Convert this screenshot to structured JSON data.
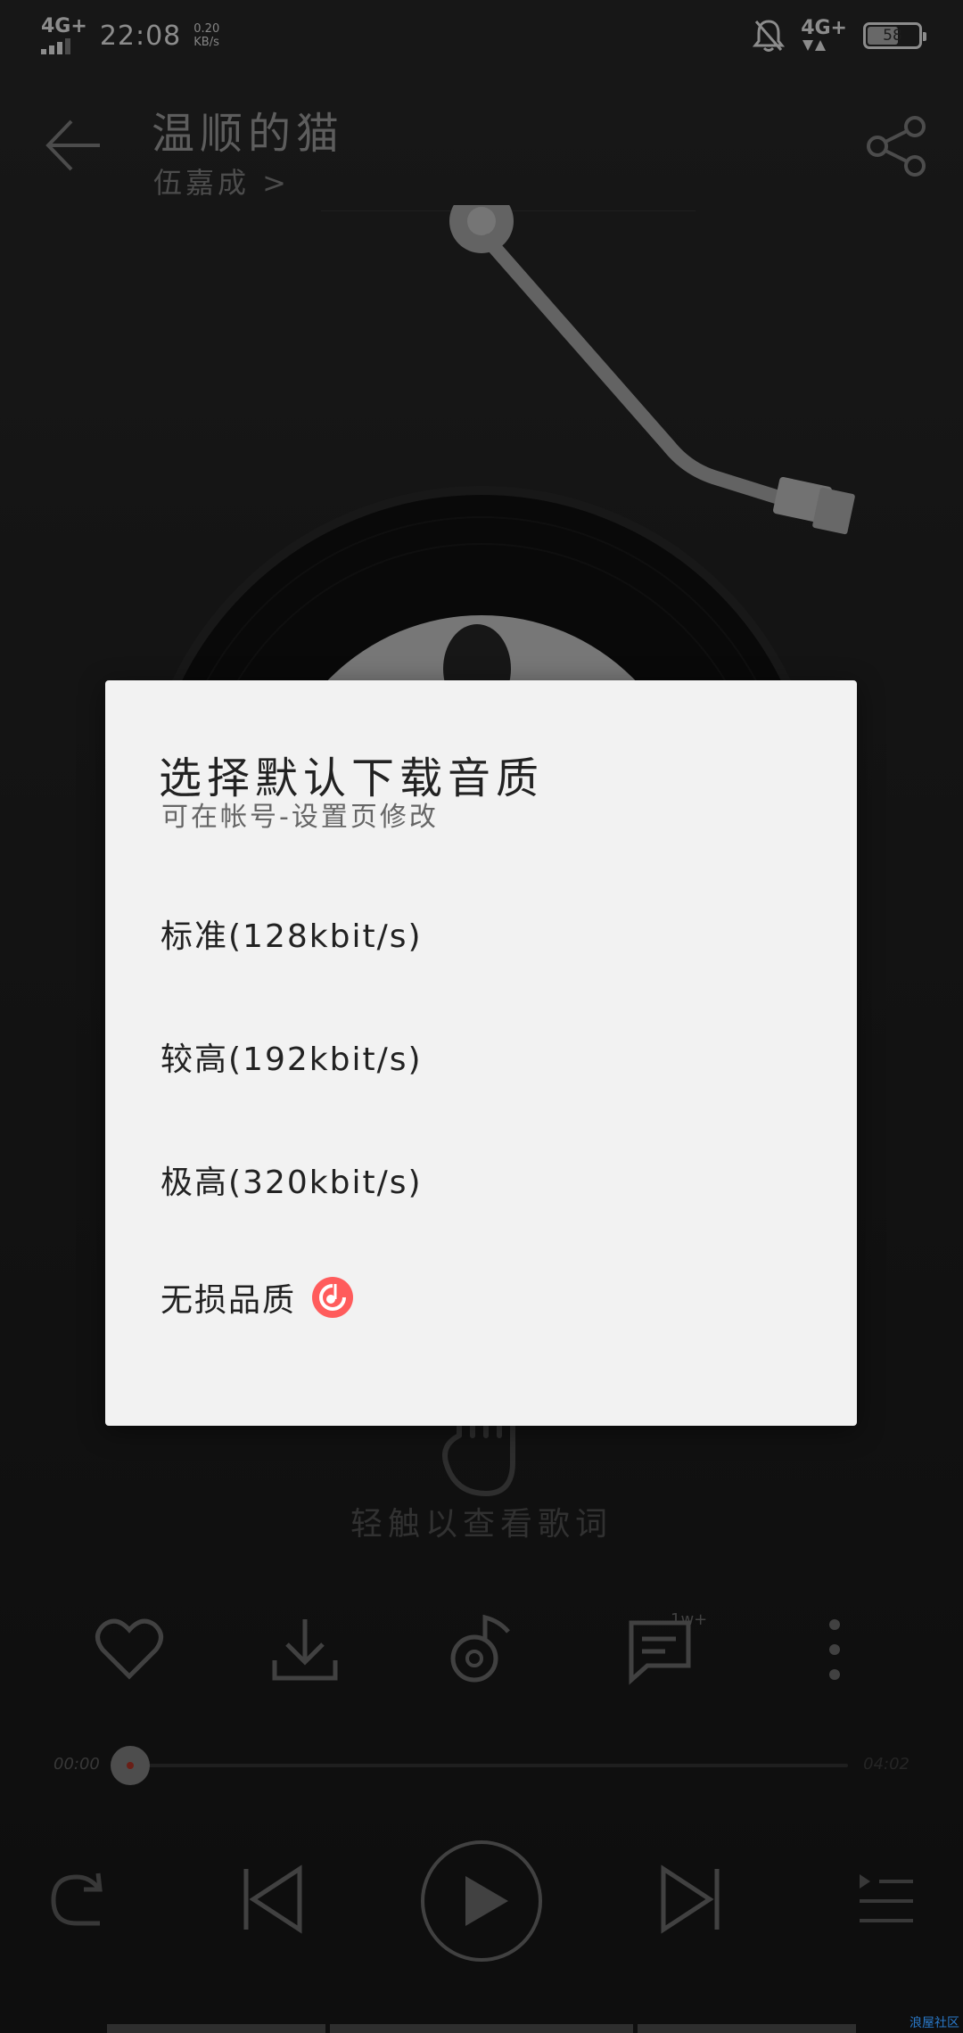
{
  "status_bar": {
    "network_left": "4G+",
    "time": "22:08",
    "speed_value": "0.20",
    "speed_unit": "KB/s",
    "network_right": "4G+",
    "battery": "58"
  },
  "header": {
    "song_title": "温顺的猫",
    "artist": "伍嘉成 >"
  },
  "lyrics_hint": "轻触以查看歌词",
  "actions": {
    "comment_badge": "1w+"
  },
  "progress": {
    "current_time": "00:00",
    "total_time": "04:02",
    "fraction": 0.0
  },
  "dialog": {
    "title": "选择默认下载音质",
    "subtitle": "可在帐号-设置页修改",
    "options": [
      {
        "label": "标准(128kbit/s)"
      },
      {
        "label": "较高(192kbit/s)"
      },
      {
        "label": "极高(320kbit/s)"
      },
      {
        "label": "无损品质",
        "icon": "vip-music-note-icon"
      }
    ]
  },
  "watermark": "浪屋社区",
  "colors": {
    "dialog_bg": "#f2f2f2",
    "accent": "#ff5c5c",
    "background": "#252525"
  }
}
